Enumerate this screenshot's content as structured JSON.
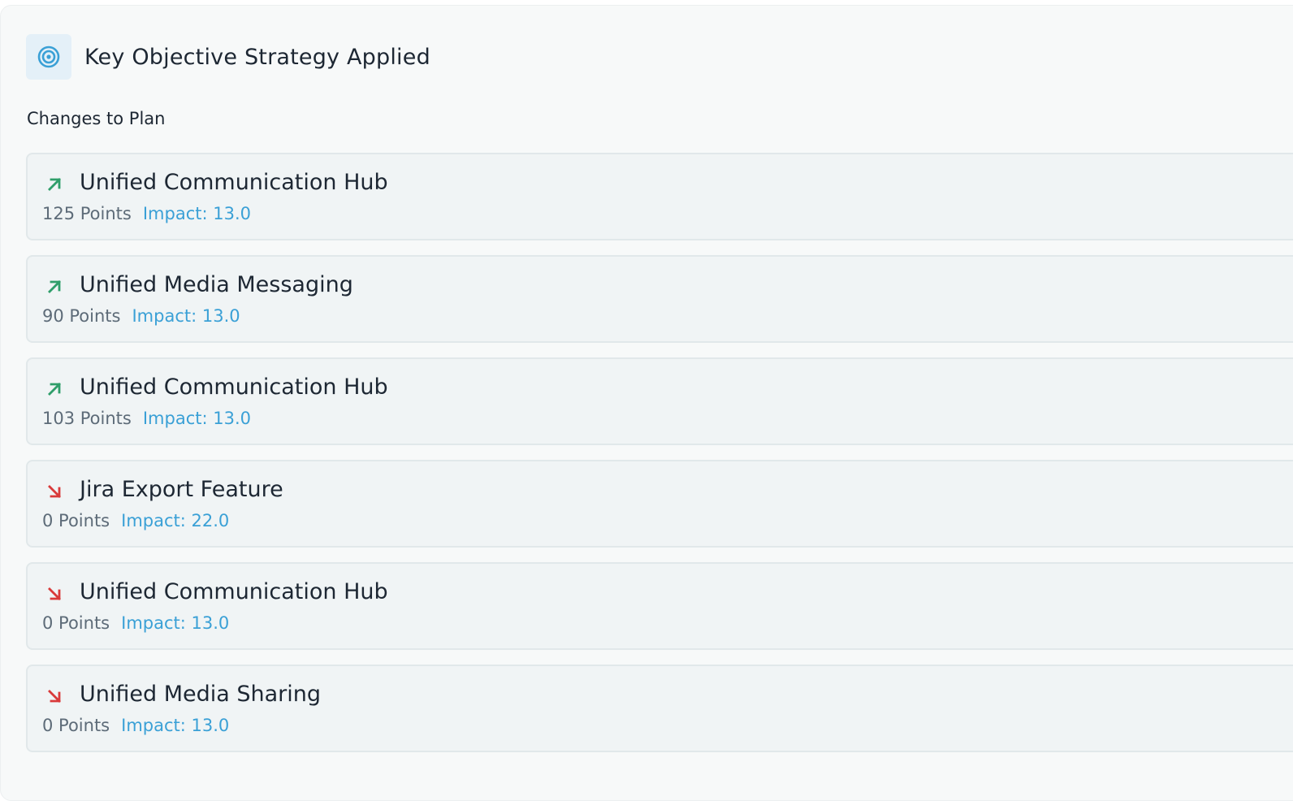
{
  "header": {
    "title": "Key Objective Strategy Applied",
    "icon": "target-icon",
    "icon_color": "#3aa0d6"
  },
  "section": {
    "label": "Changes to Plan"
  },
  "colors": {
    "increase": "#2f9e6a",
    "decrease": "#d93a3a",
    "impact": "#3aa0d6"
  },
  "changes": [
    {
      "direction": "up",
      "icon": "arrow-up-right-icon",
      "title": "Unified Communication Hub",
      "points": "125 Points",
      "impact": "Impact: 13.0"
    },
    {
      "direction": "up",
      "icon": "arrow-up-right-icon",
      "title": "Unified Media Messaging",
      "points": "90 Points",
      "impact": "Impact: 13.0"
    },
    {
      "direction": "up",
      "icon": "arrow-up-right-icon",
      "title": "Unified Communication Hub",
      "points": "103 Points",
      "impact": "Impact: 13.0"
    },
    {
      "direction": "down",
      "icon": "arrow-down-right-icon",
      "title": "Jira Export Feature",
      "points": "0 Points",
      "impact": "Impact: 22.0"
    },
    {
      "direction": "down",
      "icon": "arrow-down-right-icon",
      "title": "Unified Communication Hub",
      "points": "0 Points",
      "impact": "Impact: 13.0"
    },
    {
      "direction": "down",
      "icon": "arrow-down-right-icon",
      "title": "Unified Media Sharing",
      "points": "0 Points",
      "impact": "Impact: 13.0"
    }
  ]
}
